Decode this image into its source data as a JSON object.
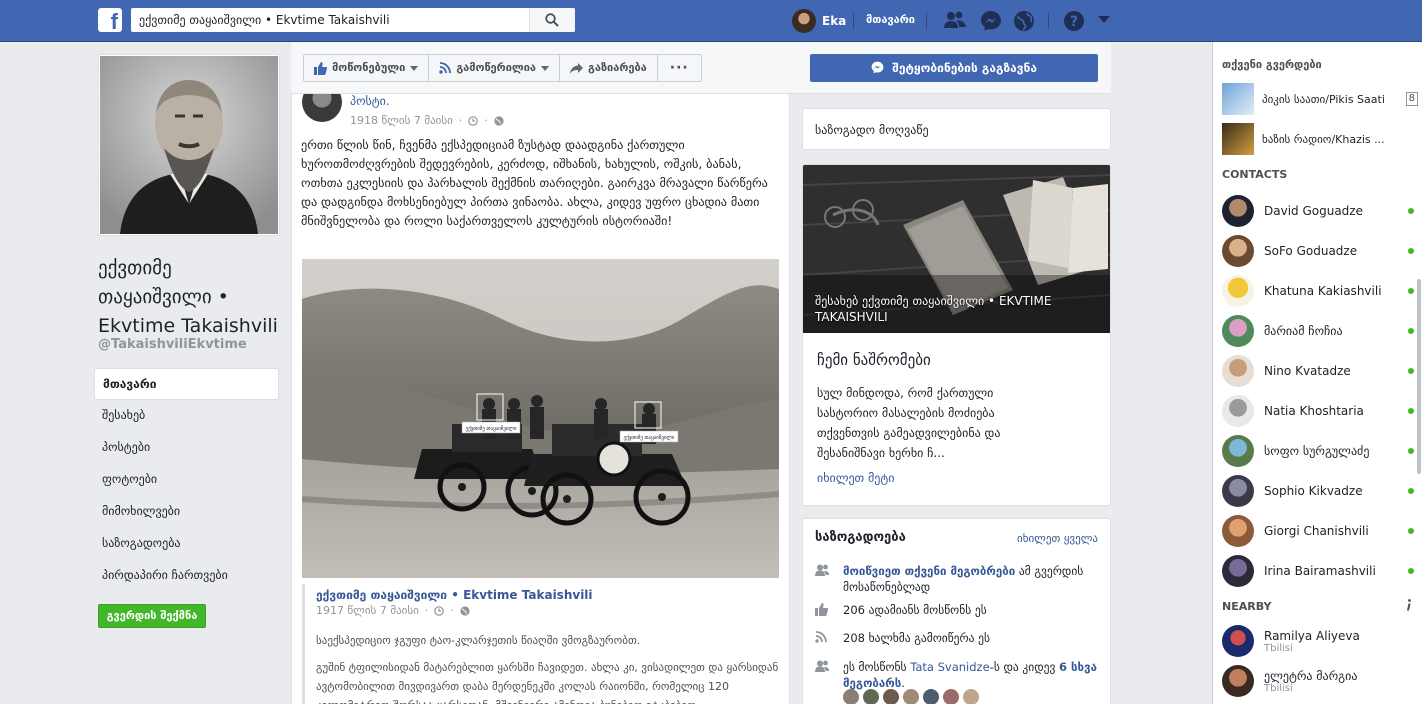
{
  "topbar": {
    "logo": "f",
    "search_value": "ექვთიმე თაყაიშვილი • Ekvtime Takaishvili",
    "user_name": "Eka",
    "home_label": "მთავარი",
    "icons": [
      "friends-icon",
      "messenger-icon",
      "globe-icon",
      "help-icon",
      "caret-down-icon"
    ]
  },
  "page": {
    "name": "ექვთიმე თაყაიშვილი • Ekvtime Takaishvili",
    "handle": "@TakaishviliEkvtime",
    "nav": [
      "მთავარი",
      "შესახებ",
      "პოსტები",
      "ფოტოები",
      "მიმოხილვები",
      "საზოგადოება",
      "პირდაპირი ჩართვები"
    ],
    "create_page": "გვერდის შექმნა"
  },
  "actions": {
    "like": "მოწონებული",
    "follow": "გამოწერილია",
    "share": "გაზიარება",
    "more": "···",
    "send_message": "შეტყობინების გაგზავნა"
  },
  "post": {
    "top_link": "პოსტი.",
    "date": "1918 წლის 7 მაისი",
    "text": "ერთი წლის წინ, ჩვენმა ექსპედიციამ ზუსტად დაადგინა ქართული ხუროთმოძღვრების შედევრების, კერძოდ, იშხანის, ხახულის, ოშკის, ბანას, ოთხთა ეკლესიის და პარხალის შექმნის თარიღები. გაირკვა მრავალი წარწერა და დადგინდა მოხსენიებულ პირთა ვინაობა. ახლა, კიდევ უფრო ცხადია მათი მნიშვნელობა და როლი საქართველოს კულტურის ისტორიაში!",
    "photo_tag_1": "ექვთიმე თაყაიშვილი",
    "photo_tag_2": "ექვთიმე თაყაიშვილი",
    "shared_author": "ექვთიმე თაყაიშვილი • Ekvtime Takaishvili",
    "shared_date": "1917 წლის 7 მაისი",
    "shared_p1": "საექსპედიციო ჯგუფი ტაო-კლარჯეთის წიაღში ვმოგზაურობთ.",
    "shared_p2": "გუშინ ტფილისიდან მატარებლით ყარსში ჩავიდეთ. ახლა კი, ვისადილეთ და ყარსიდან ავტომობილით მივდივართ დაბა მერდენეკში კოლას რაიონში, რომელიც 120 კილომეტრით შორსაა ყარსიდან. მშვენიერი ამინდია ბუნებით ვტკბებით."
  },
  "sidebar_mid": {
    "category": "საზოგადო მოღვაწე",
    "about_caption": "შესახებ ექვთიმე თაყაიშვილი • EKVTIME TAKAISHVILI",
    "about_title": "ჩემი ნაშრომები",
    "about_desc": "სულ მინდოდა, რომ ქართული სასტორიო მასალების მოძიება თქვენთვის გამეადვილებინა და შესანიშნავი ხერხი ჩ...",
    "about_more": "იხილეთ მეტი",
    "community_title": "საზოგადოება",
    "community_see_all": "იხილეთ ყველა",
    "invite_link": "მოიწვიეთ თქვენი მეგობრები",
    "invite_rest": " ამ გვერდის მოსაწონებლად",
    "likes": "206 ადამიანს მოსწონს ეს",
    "follows": "208 ხალხმა გამოიწერა ეს",
    "friends_pre": "ეს მოსწონს ",
    "friend_name": "Tata Svanidze",
    "friends_mid": "-ს და კიდევ ",
    "friends_count": "6 სხვა მეგობარს",
    "friends_end": "."
  },
  "chat": {
    "pages_title": "თქვენი გვერდები",
    "pages": [
      {
        "label": "პიკის საათი/Pikis Saati",
        "count": "8"
      },
      {
        "label": "ხაზის რადიო/Khazis ...",
        "count": ""
      }
    ],
    "contacts_title": "CONTACTS",
    "contacts": [
      "David Goguadze",
      "SoFo Goduadze",
      "Khatuna Kakiashvili",
      "მარიამ ჩოჩია",
      "Nino Kvatadze",
      "Natia Khoshtaria",
      "სოფო სურგულაძე",
      "Sophio Kikvadze",
      "Giorgi Chanishvili",
      "Irina Bairamashvili"
    ],
    "nearby_title": "NEARBY",
    "nearby": [
      {
        "name": "Ramilya Aliyeva",
        "place": "Tbilisi"
      },
      {
        "name": "ელეტრა მარგია",
        "place": "Tbilisi"
      }
    ]
  },
  "colors": {
    "brand": "#4267b2",
    "online": "#42b72a",
    "link": "#365899"
  }
}
